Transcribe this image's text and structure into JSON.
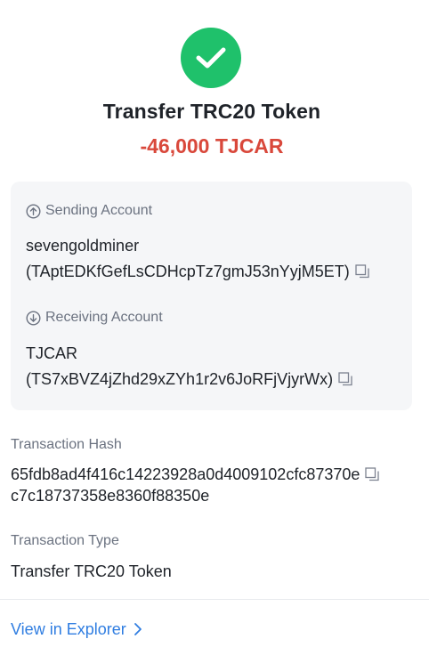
{
  "status": {
    "icon": "check-icon"
  },
  "title": "Transfer TRC20 Token",
  "amount": "-46,000 TJCAR",
  "colors": {
    "success": "#1fc16b",
    "negative": "#d9483b",
    "link": "#2f7de1"
  },
  "sending": {
    "label": "Sending Account",
    "icon": "arrow-up-circle-icon",
    "name": "sevengoldminer",
    "address": "(TAptEDKfGefLsCDHcpTz7gmJ53nYyjM5ET)"
  },
  "receiving": {
    "label": "Receiving Account",
    "icon": "arrow-down-circle-icon",
    "name": "TJCAR",
    "address": "(TS7xBVZ4jZhd29xZYh1r2v6JoRFjVjyrWx)"
  },
  "hash": {
    "label": "Transaction Hash",
    "line1": "65fdb8ad4f416c14223928a0d4009102cfc87370e",
    "line2": "c7c18737358e8360f88350e"
  },
  "type": {
    "label": "Transaction Type",
    "value": "Transfer TRC20 Token"
  },
  "explorer": {
    "label": "View in Explorer",
    "icon": "chevron-right-icon"
  }
}
